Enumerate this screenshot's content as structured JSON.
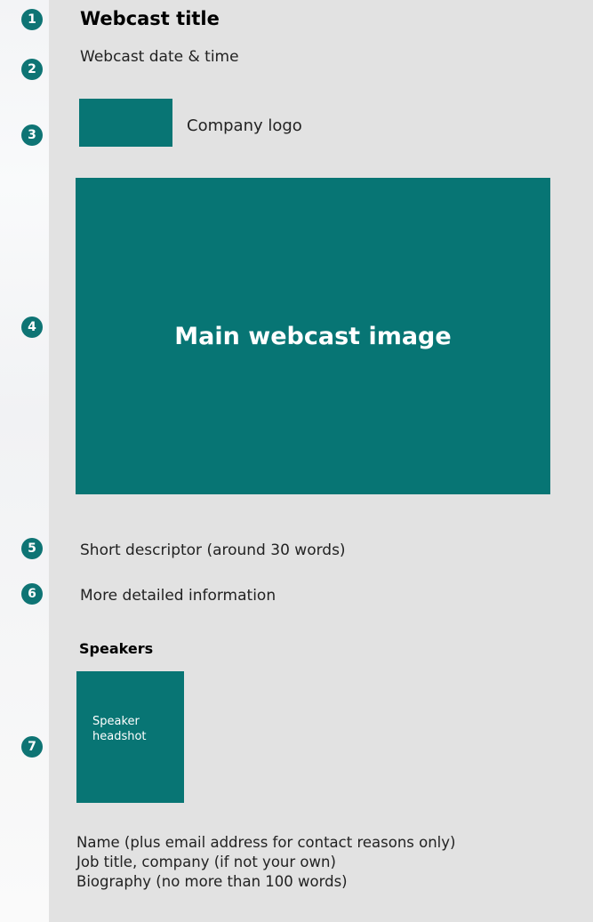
{
  "steps": [
    "1",
    "2",
    "3",
    "4",
    "5",
    "6",
    "7"
  ],
  "header": {
    "title": "Webcast title",
    "date_time": "Webcast date & time"
  },
  "logo": {
    "label": "Company logo"
  },
  "main_image": {
    "label": "Main webcast image"
  },
  "descriptor": "Short descriptor (around 30 words)",
  "detailed_info": "More detailed information",
  "speakers": {
    "heading": "Speakers",
    "headshot_label": "Speaker headshot",
    "info_lines": [
      "Name (plus email address for contact reasons only)",
      "Job title, company (if not your own)",
      "Biography (no more than 100 words)"
    ]
  },
  "colors": {
    "accent": "#077574",
    "badge": "#0e7474",
    "panel_bg": "#e2e2e2"
  }
}
